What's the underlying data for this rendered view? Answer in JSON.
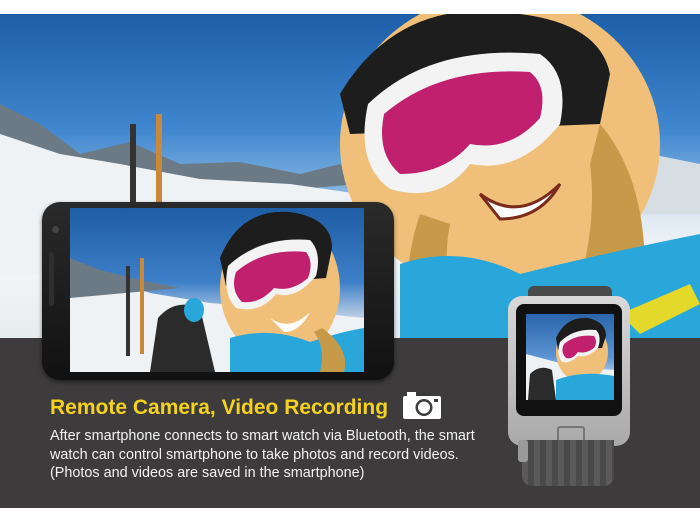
{
  "feature": {
    "title": "Remote Camera, Video Recording",
    "description": "After smartphone connects to smart watch via Bluetooth, the smart watch can control smartphone to take photos and record videos. (Photos and videos are saved in the smartphone)"
  },
  "icons": {
    "camera": "camera-icon"
  },
  "colors": {
    "title": "#f5d21f",
    "band": "#3d3b3c",
    "text": "#f2f2f2",
    "goggles": "#e6267f",
    "jacket": "#29a6da"
  }
}
